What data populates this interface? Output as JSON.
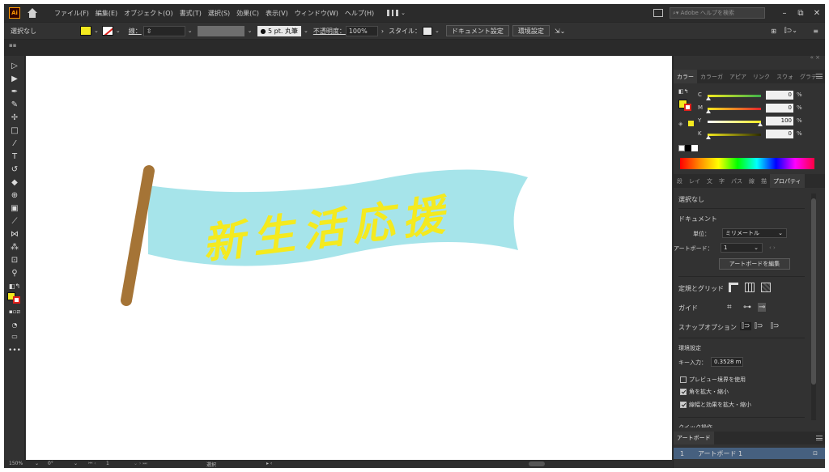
{
  "menubar": {
    "logo": "Ai",
    "items": [
      "ファイル(F)",
      "編集(E)",
      "オブジェクト(O)",
      "書式(T)",
      "選択(S)",
      "効果(C)",
      "表示(V)",
      "ウィンドウ(W)",
      "ヘルプ(H)"
    ],
    "search_placeholder": "Adobe ヘルプを検索",
    "minimize": "–",
    "restore": "⧉",
    "close": "✕"
  },
  "controlbar": {
    "selection": "選択なし",
    "stroke_label": "線：",
    "brush": "●  5 pt. 丸筆",
    "opacity_label": "不透明度：",
    "opacity_value": "100%",
    "style_label": "スタイル：",
    "doc_settings": "ドキュメント設定",
    "preferences": "環境設定"
  },
  "colors": {
    "fill": "#f4ea1f",
    "flag_fill": "#a6e4ea",
    "pole": "#a57436",
    "text": "#f4ea1f",
    "accent_blue": "#46607f"
  },
  "artwork": {
    "banner_text": "新生活応援"
  },
  "color_panel": {
    "tabs": [
      "カラー",
      "カラーガ",
      "アピア",
      "リンク",
      "スウォ",
      "グラデ"
    ],
    "cmyk": [
      {
        "label": "C",
        "value": "0",
        "unit": "%"
      },
      {
        "label": "M",
        "value": "0",
        "unit": "%"
      },
      {
        "label": "Y",
        "value": "100",
        "unit": "%"
      },
      {
        "label": "K",
        "value": "0",
        "unit": "%"
      }
    ]
  },
  "properties_panel": {
    "tabs": [
      "段",
      "レイ",
      "文",
      "字",
      "パス",
      "線",
      "描",
      "プロパティ"
    ],
    "no_selection": "選択なし",
    "document_header": "ドキュメント",
    "unit_label": "単位：",
    "unit_value": "ミリメートル",
    "artboard_label": "アートボード：",
    "artboard_value": "1",
    "edit_artboard": "アートボードを編集",
    "rulers_grids": "定規とグリッド",
    "guides": "ガイド",
    "snap_options": "スナップオプション",
    "preferences_header": "環境設定",
    "key_increment_label": "キー入力：",
    "key_increment_value": "0.3528 m",
    "preview_bounds": "プレビュー境界を使用",
    "scale_corners": "角を拡大・縮小",
    "scale_strokes": "線幅と効果を拡大・縮小",
    "quick_actions": "クイック操作"
  },
  "artboards_panel": {
    "title": "アートボード",
    "rows": [
      {
        "index": "1",
        "name": "アートボード 1"
      }
    ]
  },
  "statusbar": {
    "zoom": "150%",
    "rotation": "0°",
    "artboard_nav": "1",
    "tool": "選択"
  }
}
